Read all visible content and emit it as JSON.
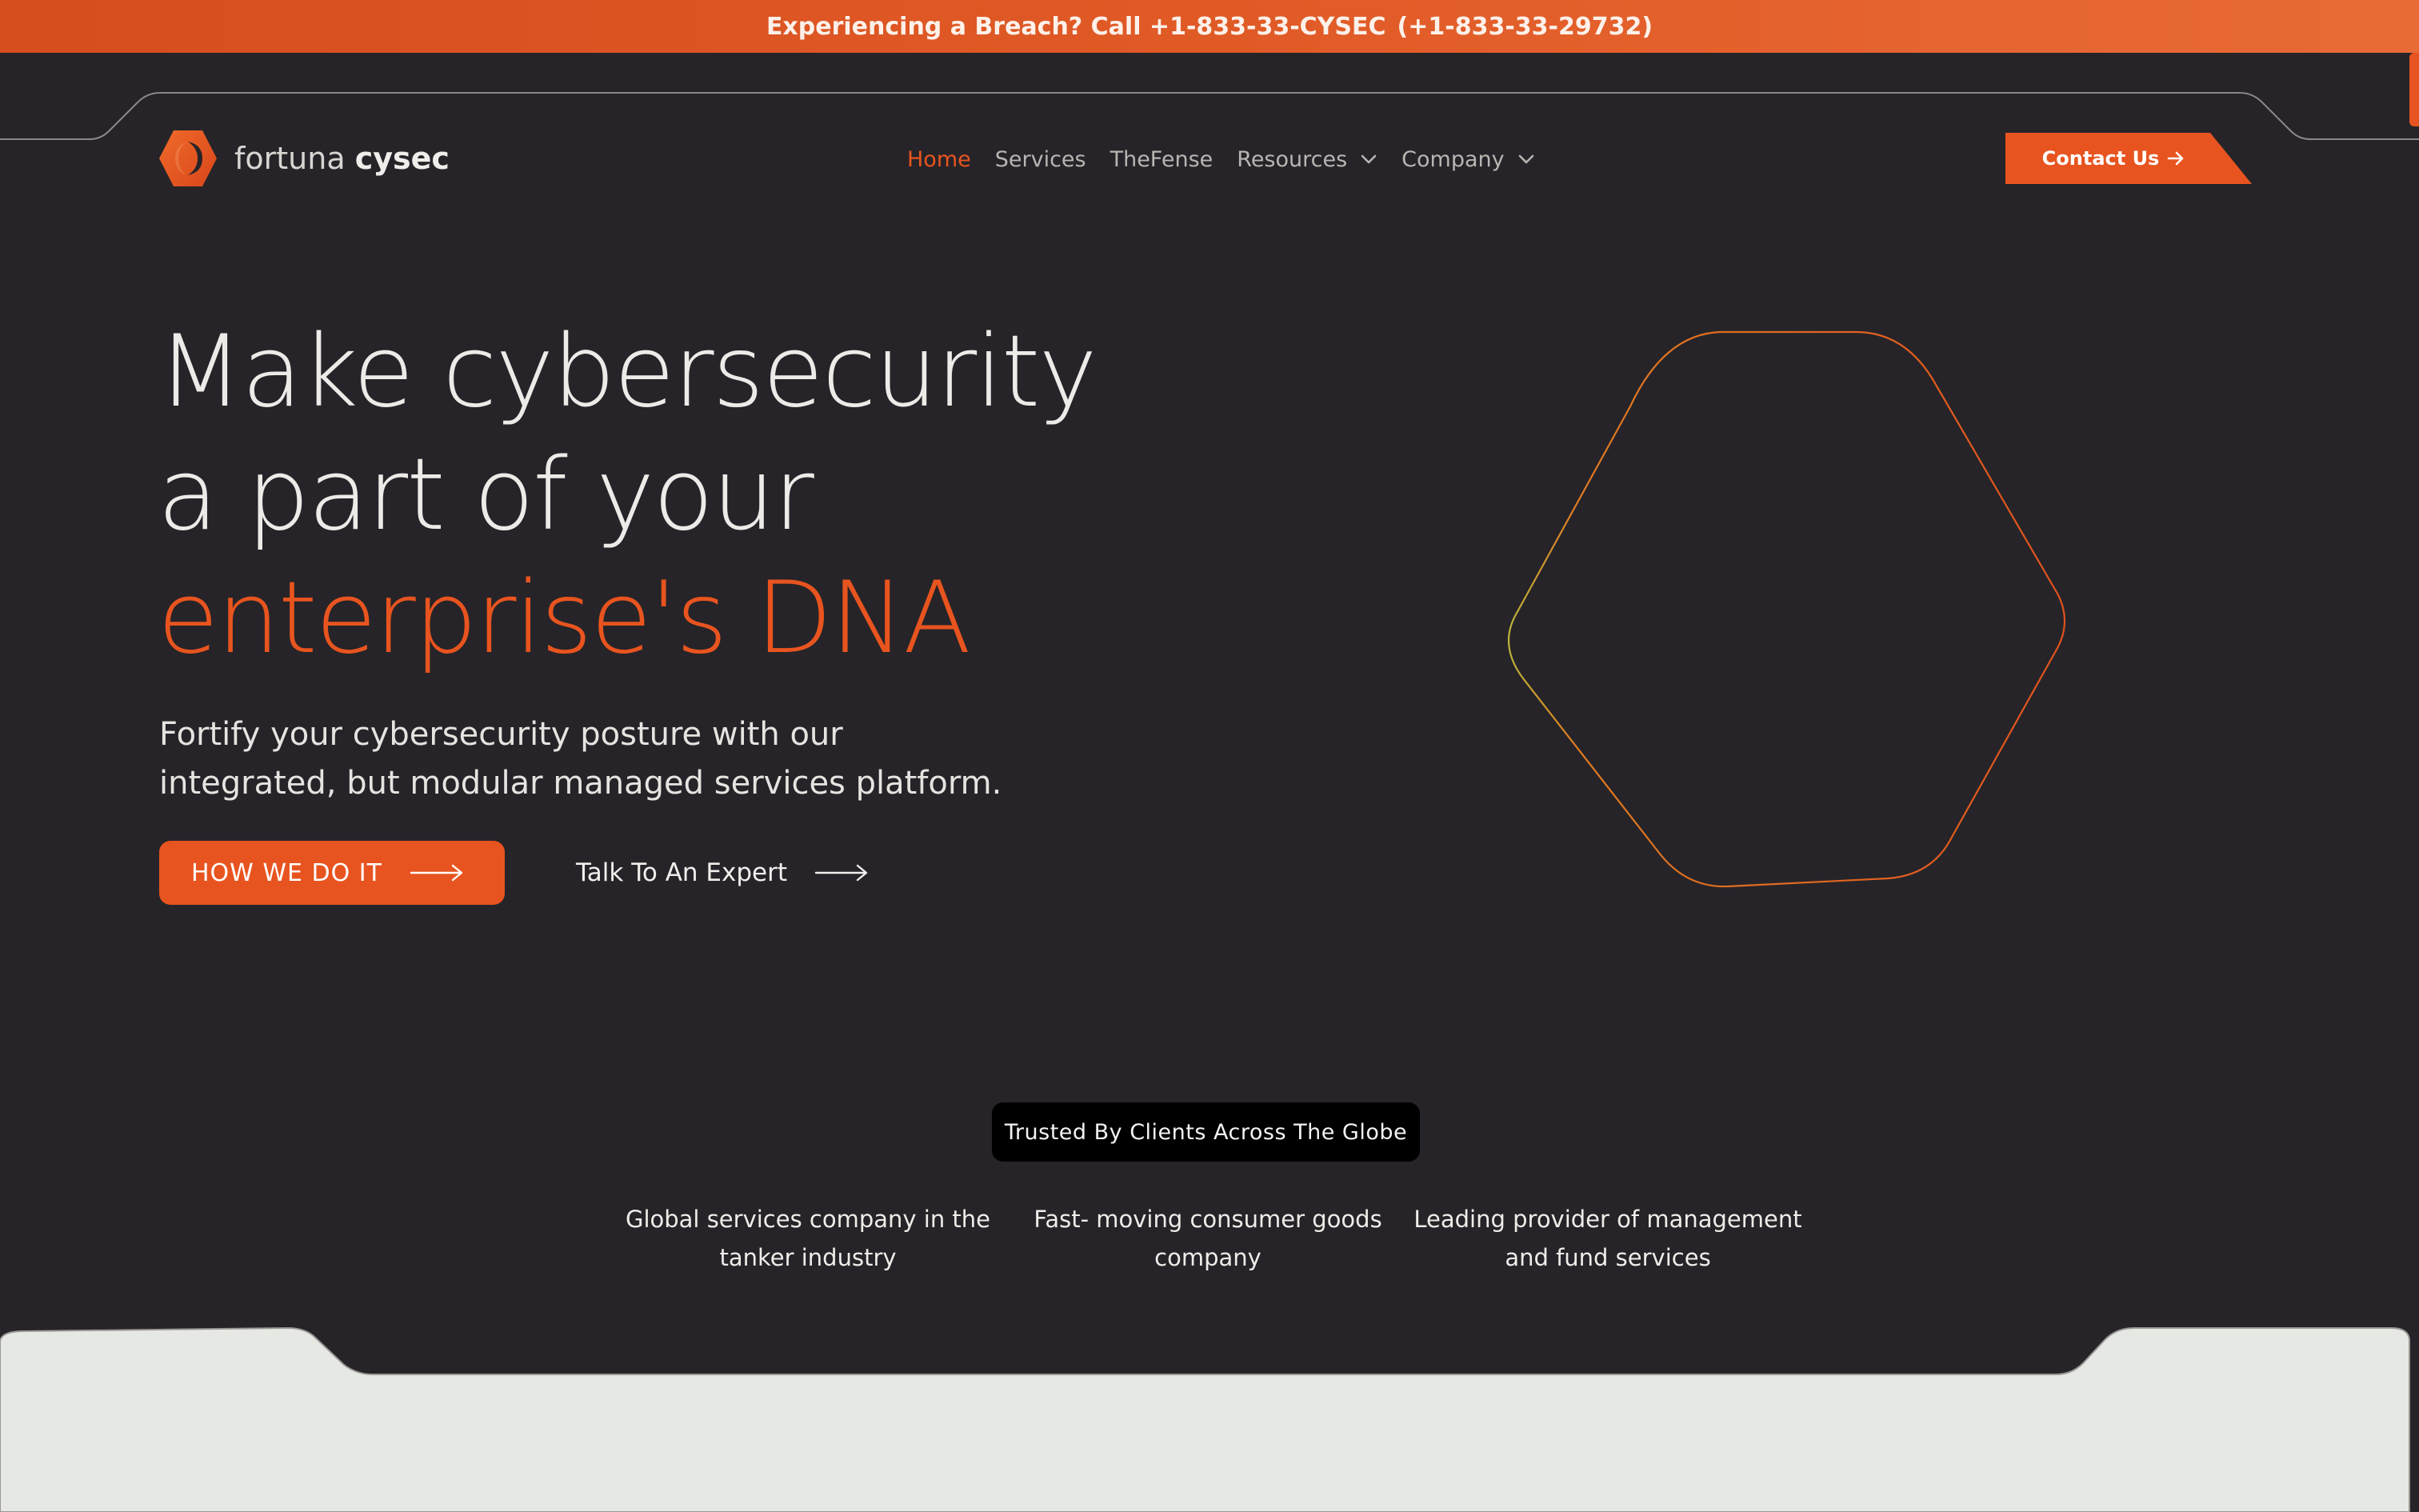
{
  "alert": {
    "text": "Experiencing a Breach? Call +1-833-33-CYSEC",
    "number": "(+1-833-33-29732)"
  },
  "brand": {
    "name_light": "fortuna",
    "name_bold": "cysec",
    "logo_icon": "hexagon-ring-icon",
    "accent_color": "#e8541f"
  },
  "nav": {
    "items": [
      {
        "label": "Home",
        "active": true
      },
      {
        "label": "Services"
      },
      {
        "label": "TheFense"
      },
      {
        "label": "Resources",
        "has_dropdown": true
      },
      {
        "label": "Company",
        "has_dropdown": true
      }
    ],
    "contact_label": "Contact Us",
    "contact_icon": "arrow-right-icon"
  },
  "hero": {
    "line1": "Make cybersecurity",
    "line2": "a part of your",
    "line3": "enterprise's DNA",
    "subtitle_line1": "Fortify your cybersecurity posture with our",
    "subtitle_line2": "integrated, but modular managed services platform.",
    "primary_cta": "HOW WE DO IT",
    "secondary_cta": "Talk To An Expert",
    "art_icon": "hexagon-outline-icon"
  },
  "trusted": {
    "badge": "Trusted By Clients Across The Globe",
    "clients": [
      {
        "line1": "Global services company in the",
        "line2": "tanker industry"
      },
      {
        "line1": "Fast- moving consumer goods",
        "line2": "company"
      },
      {
        "line1": "Leading provider of management",
        "line2": "and fund services"
      }
    ]
  },
  "colors": {
    "background": "#262428",
    "accent": "#e8541f",
    "light_section": "#e6e8e3"
  }
}
